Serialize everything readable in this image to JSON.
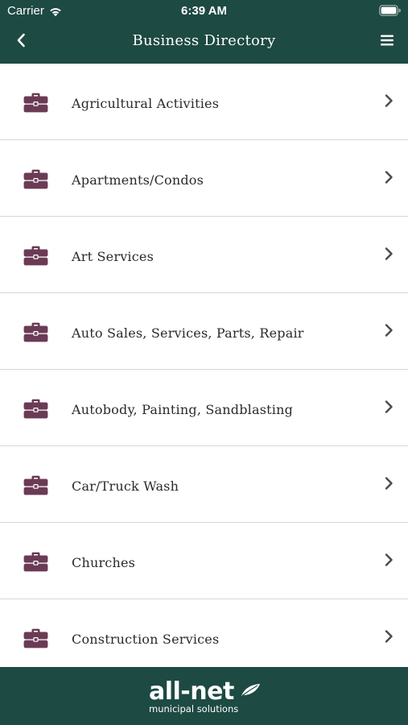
{
  "status_bar": {
    "carrier": "Carrier",
    "time": "6:39 AM"
  },
  "nav": {
    "title": "Business Directory",
    "back_icon": "chevron-left-icon",
    "menu_icon": "hamburger-menu-icon"
  },
  "categories": [
    {
      "label": "Agricultural Activities"
    },
    {
      "label": "Apartments/Condos"
    },
    {
      "label": "Art Services"
    },
    {
      "label": "Auto Sales, Services, Parts, Repair"
    },
    {
      "label": "Autobody, Painting, Sandblasting"
    },
    {
      "label": "Car/Truck Wash"
    },
    {
      "label": "Churches"
    },
    {
      "label": "Construction Services"
    }
  ],
  "list_icons": {
    "row_icon": "briefcase-icon",
    "row_accessory": "chevron-right-icon"
  },
  "footer": {
    "logo_text": "all-net",
    "logo_tagline": "municipal solutions"
  },
  "colors": {
    "header_bg": "#1d4a43",
    "footer_bg": "#1d4a43",
    "icon_color": "#6b3b55",
    "chevron_color": "#4a4a4a",
    "divider": "#d6d6d6"
  }
}
